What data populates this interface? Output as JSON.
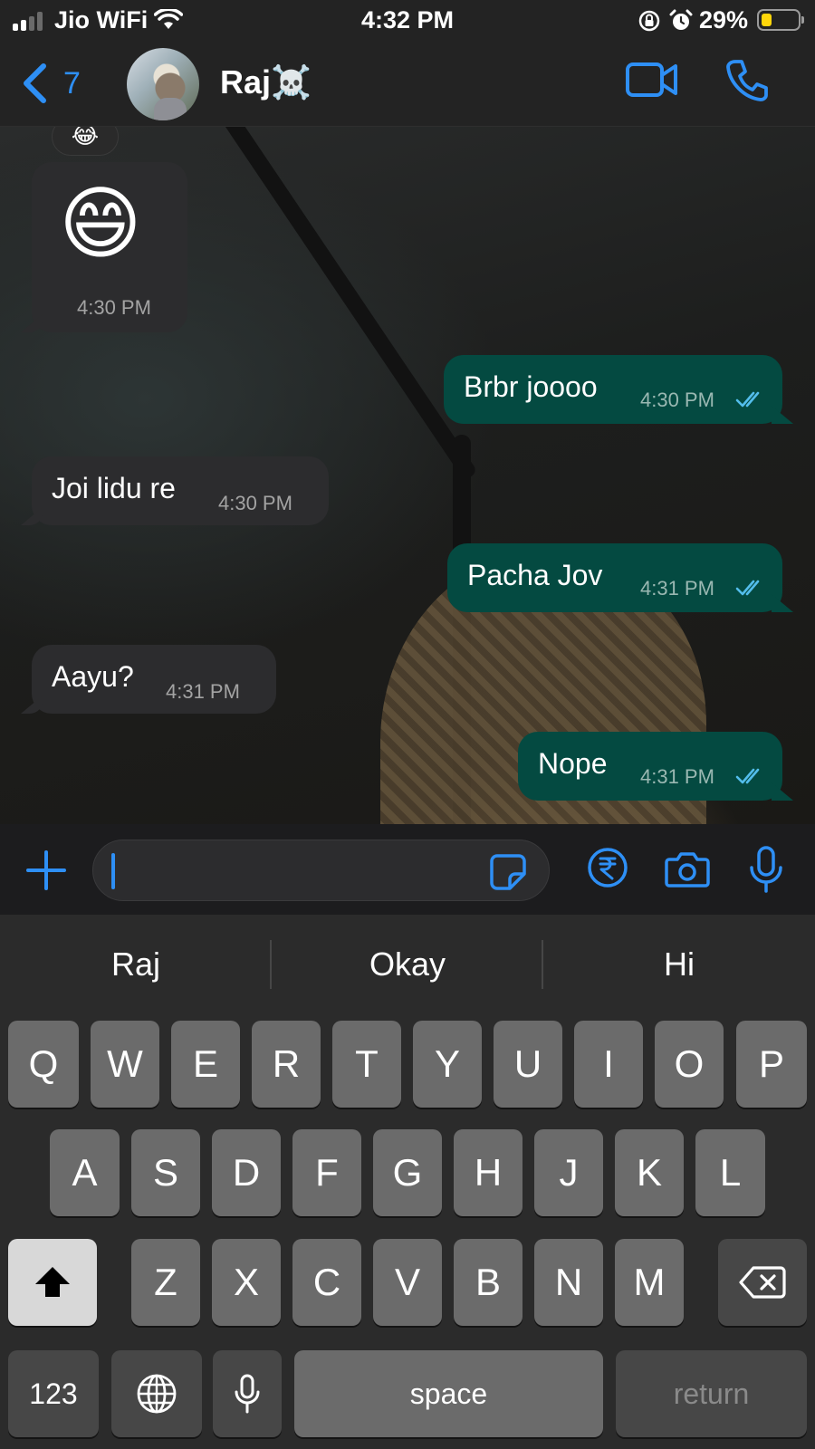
{
  "status_bar": {
    "carrier": "Jio WiFi",
    "time": "4:32 PM",
    "battery_percent_label": "29%",
    "battery_level": 0.29,
    "battery_color": "#ffd60a"
  },
  "header": {
    "back_count": "7",
    "contact_name": "Raj☠️",
    "avatar_icon": "avatar",
    "accent_color": "#2e8ff5"
  },
  "messages": [
    {
      "direction": "in",
      "type": "emoji",
      "reaction": "😂",
      "text": "😄",
      "time": "4:30 PM"
    },
    {
      "direction": "out",
      "text": "Brbr joooo",
      "time": "4:30 PM",
      "status": "read"
    },
    {
      "direction": "in",
      "text": "Joi lidu re",
      "time": "4:30 PM"
    },
    {
      "direction": "out",
      "text": "Pacha Jov",
      "time": "4:31 PM",
      "status": "read"
    },
    {
      "direction": "in",
      "text": "Aayu?",
      "time": "4:31 PM"
    },
    {
      "direction": "out",
      "text": "Nope",
      "time": "4:31 PM",
      "status": "read"
    }
  ],
  "input": {
    "value": "",
    "icons": [
      "plus-icon",
      "sticker-icon",
      "rupee-icon",
      "camera-icon",
      "microphone-icon"
    ]
  },
  "keyboard": {
    "suggestions": [
      "Raj",
      "Okay",
      "Hi"
    ],
    "row1": [
      "Q",
      "W",
      "E",
      "R",
      "T",
      "Y",
      "U",
      "I",
      "O",
      "P"
    ],
    "row2": [
      "A",
      "S",
      "D",
      "F",
      "G",
      "H",
      "J",
      "K",
      "L"
    ],
    "row3": [
      "Z",
      "X",
      "C",
      "V",
      "B",
      "N",
      "M"
    ],
    "numbers_label": "123",
    "space_label": "space",
    "return_label": "return"
  }
}
